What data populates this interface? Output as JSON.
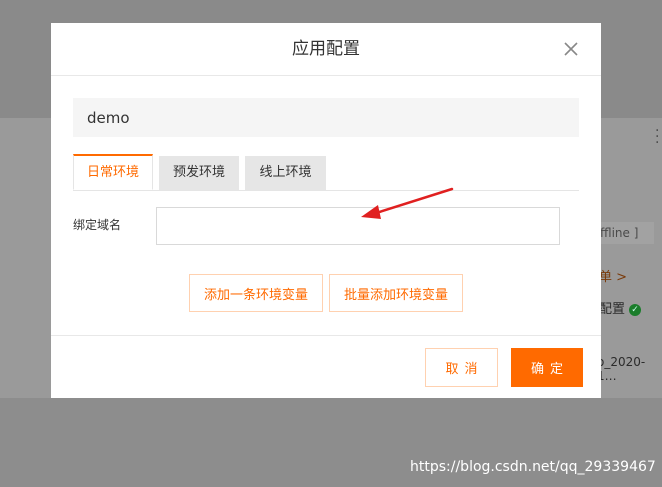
{
  "background": {
    "offline_label": "ffline ]",
    "list_link": "单 >",
    "config_label": "配置",
    "app_name": "o_2020-1…",
    "more_icon": "vertical-dots"
  },
  "modal": {
    "title": "应用配置",
    "close_icon": "close-x",
    "name_value": "demo",
    "tabs": [
      {
        "label": "日常环境",
        "active": true
      },
      {
        "label": "预发环境",
        "active": false
      },
      {
        "label": "线上环境",
        "active": false
      }
    ],
    "domain_label": "绑定域名",
    "domain_value": "",
    "add_one_label": "添加一条环境变量",
    "batch_add_label": "批量添加环境变量",
    "cancel_label": "取消",
    "confirm_label": "确定"
  },
  "watermark": "https://blog.csdn.net/qq_29339467",
  "colors": {
    "accent": "#ff6a00",
    "annotation_arrow": "#e02020"
  }
}
